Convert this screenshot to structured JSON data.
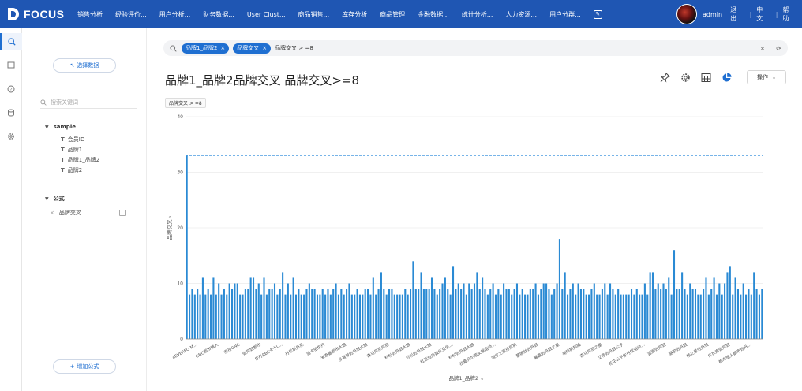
{
  "app": {
    "logo_text": "FOCUS"
  },
  "nav": {
    "items": [
      "销售分析",
      "经验评价...",
      "用户分析...",
      "财务数据...",
      "User Clust...",
      "商品销售...",
      "库存分析",
      "商品管理",
      "金融数据...",
      "统计分析...",
      "人力资源...",
      "用户分群..."
    ],
    "edit_icon": "edit-icon"
  },
  "user": {
    "name": "admin",
    "logout": "退出",
    "language": "中文",
    "help": "帮助"
  },
  "rail": {
    "icons": [
      "search-icon",
      "dashboard-icon",
      "question-icon",
      "database-icon",
      "settings-icon"
    ]
  },
  "sidebar": {
    "choose_data": "选择数据",
    "search_placeholder": "搜索关键词",
    "tree_title": "sample",
    "tree_items": [
      "会员ID",
      "品牌1",
      "品牌1_品牌2",
      "品牌2"
    ],
    "formula_title": "公式",
    "formula_item": "品牌交叉",
    "add_formula": "增加公式"
  },
  "searchbar": {
    "chips": [
      "品牌1_品牌2",
      "品牌交叉"
    ],
    "text": "品牌交叉 > =8"
  },
  "page": {
    "title": "品牌1_品牌2品牌交叉 品牌交叉>=8",
    "operate_button": "操作",
    "filter_tag": "品牌交叉 > =8"
  },
  "chart_data": {
    "type": "bar",
    "xlabel": "品牌1_品牌2",
    "ylabel": "品牌交叉",
    "ylim": [
      0,
      40
    ],
    "yticks": [
      0,
      10,
      20,
      30,
      40
    ],
    "reference_lines": [
      33,
      9
    ],
    "tick_labels": [
      "nEVERFO M...",
      "GNC都市情人",
      "乔丹GNC",
      "佐丹奴都市",
      "佐丹ABC卡卡L...",
      "丹尼斯丹尼",
      "迪卡依佐丹",
      "米奇曼都市大娘",
      "多喜爱佐丹奴大娘",
      "森马丹尼丹尼",
      "杉杉佐丹奴大娘",
      "杉杉佐丹奴大娘",
      "红豆佐丹奴红豆佐...",
      "杉杉佐丹奴大娘",
      "拉夏贝尔淑女屋运动...",
      "淘宝之家丹尼斯",
      "蔓娜丝佐丹奴",
      "嘉嘉佐丹奴之星",
      "美特斯邦威",
      "森马丹尼之星",
      "艾格佐丹奴公子",
      "花花公子佐丹奴运动...",
      "蓝图佐丹奴",
      "骆驼佐丹奴",
      "格之星佐丹奴",
      "优衣库佐丹奴",
      "都市情人都市佐丹..."
    ],
    "values": [
      33,
      8,
      9,
      8,
      9,
      8,
      11,
      8,
      9,
      8,
      11,
      8,
      10,
      8,
      9,
      8,
      10,
      9,
      10,
      10,
      8,
      8,
      9,
      9,
      11,
      11,
      9,
      10,
      8,
      11,
      8,
      9,
      9,
      10,
      8,
      9,
      12,
      8,
      10,
      8,
      11,
      8,
      9,
      8,
      8,
      9,
      10,
      9,
      9,
      8,
      8,
      9,
      8,
      9,
      8,
      9,
      10,
      8,
      9,
      8,
      9,
      10,
      8,
      8,
      9,
      8,
      8,
      9,
      9,
      8,
      11,
      8,
      9,
      12,
      9,
      8,
      9,
      9,
      8,
      8,
      8,
      8,
      9,
      8,
      9,
      14,
      9,
      9,
      12,
      9,
      9,
      9,
      11,
      9,
      8,
      9,
      10,
      11,
      9,
      8,
      13,
      9,
      10,
      9,
      10,
      8,
      10,
      9,
      10,
      12,
      9,
      11,
      9,
      8,
      9,
      10,
      8,
      9,
      8,
      10,
      9,
      9,
      8,
      9,
      10,
      8,
      9,
      8,
      8,
      9,
      9,
      10,
      8,
      9,
      10,
      10,
      9,
      8,
      9,
      10,
      18,
      9,
      12,
      8,
      9,
      10,
      8,
      10,
      9,
      9,
      8,
      8,
      9,
      10,
      8,
      8,
      9,
      10,
      8,
      10,
      9,
      8,
      9,
      8,
      8,
      8,
      8,
      9,
      8,
      9,
      8,
      8,
      10,
      8,
      12,
      12,
      9,
      10,
      9,
      10,
      9,
      11,
      8,
      16,
      9,
      9,
      12,
      9,
      8,
      10,
      9,
      9,
      8,
      8,
      9,
      11,
      8,
      9,
      11,
      8,
      10,
      8,
      10,
      12,
      13,
      8,
      11,
      9,
      8,
      10,
      8,
      9,
      8,
      12,
      9,
      8,
      9
    ]
  }
}
